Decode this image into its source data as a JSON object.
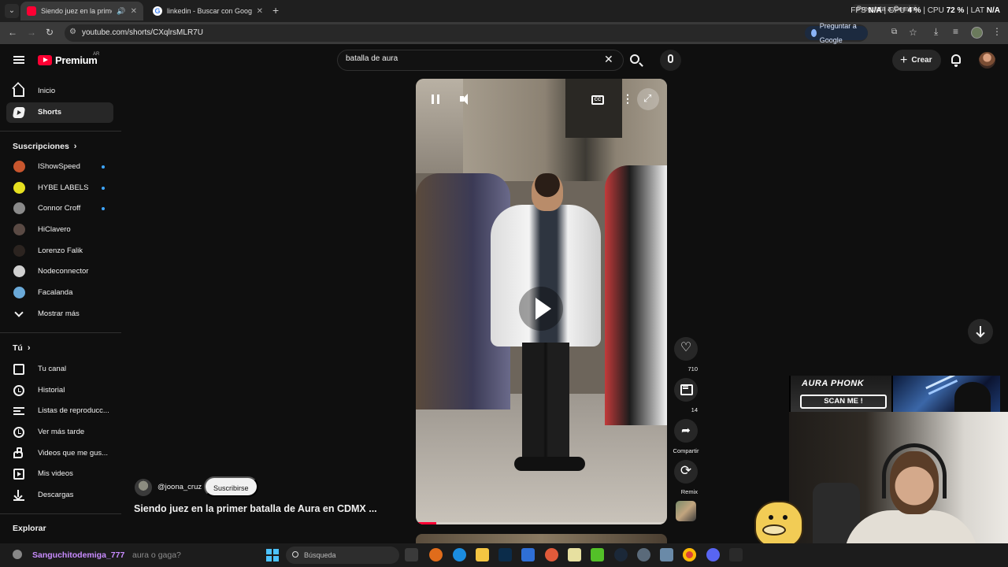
{
  "browser": {
    "tabs": [
      {
        "title": "Siendo juez en la primer ba",
        "active": true,
        "favicon": "youtube-icon"
      },
      {
        "title": "linkedin - Buscar con Google",
        "active": false,
        "favicon": "google-icon"
      }
    ],
    "new_tab": "+",
    "perf": {
      "fps_label": "FPS",
      "fps_value": "N/A",
      "gpu_label": "GPU",
      "gpu_value": "4 %",
      "cpu_label": "CPU",
      "cpu_value": "72 %",
      "lat_label": "LAT",
      "lat_value": "N/A"
    },
    "gemini_pill": "Pregunta a Gemini",
    "url": "youtube.com/shorts/CXqlrsMLR7U",
    "ask_google": "Preguntar a Google"
  },
  "youtube": {
    "logo_text": "Premium",
    "logo_country": "AR",
    "search_value": "batalla de aura",
    "crear_label": "Crear",
    "colors": {
      "brand": "#ff0033",
      "accent": "#3ea6ff",
      "bg": "#0f0f0f"
    }
  },
  "sidebar": {
    "main": [
      {
        "label": "Inicio",
        "icon": "home-icon"
      },
      {
        "label": "Shorts",
        "icon": "shorts-icon",
        "active": true
      }
    ],
    "subs_title": "Suscripciones",
    "subscriptions": [
      {
        "label": "IShowSpeed",
        "live": true,
        "color": "#c8562e"
      },
      {
        "label": "HYBE LABELS",
        "live": true,
        "color": "#e6e020"
      },
      {
        "label": "Connor Croff",
        "live": true,
        "color": "#8a8a8a"
      },
      {
        "label": "HiClavero",
        "live": false,
        "color": "#5a4a44"
      },
      {
        "label": "Lorenzo Falik",
        "live": false,
        "color": "#2c2420"
      },
      {
        "label": "Nodeconnector",
        "live": false,
        "color": "#d0d0d0"
      },
      {
        "label": "Facalanda",
        "live": false,
        "color": "#6aa9d8"
      }
    ],
    "show_more": "Mostrar más",
    "you_title": "Tú",
    "you_items": [
      {
        "label": "Tu canal",
        "icon": "channel-icon"
      },
      {
        "label": "Historial",
        "icon": "history-icon"
      },
      {
        "label": "Listas de reproducc...",
        "icon": "playlist-icon"
      },
      {
        "label": "Ver más tarde",
        "icon": "watch-later-icon"
      },
      {
        "label": "Videos que me gus...",
        "icon": "liked-icon"
      },
      {
        "label": "Mis videos",
        "icon": "my-videos-icon"
      },
      {
        "label": "Descargas",
        "icon": "download-icon"
      }
    ],
    "explore_title": "Explorar"
  },
  "short": {
    "channel_handle": "@joona_cruz",
    "subscribe_label": "Suscribirse",
    "title": "Siendo juez en la primer batalla de Aura en CDMX ...",
    "cc_label": "CC",
    "progress": 0.08,
    "likes": "710",
    "comments": "14",
    "share_label": "Compartir",
    "remix_label": "Remix"
  },
  "overlay": {
    "banner_title": "AURA PHONK",
    "banner_button": "SCAN ME !"
  },
  "chat": {
    "user": "Sanguchitodemiga_777",
    "message": "aura o gaga?"
  },
  "taskbar": {
    "search_placeholder": "Búsqueda"
  }
}
